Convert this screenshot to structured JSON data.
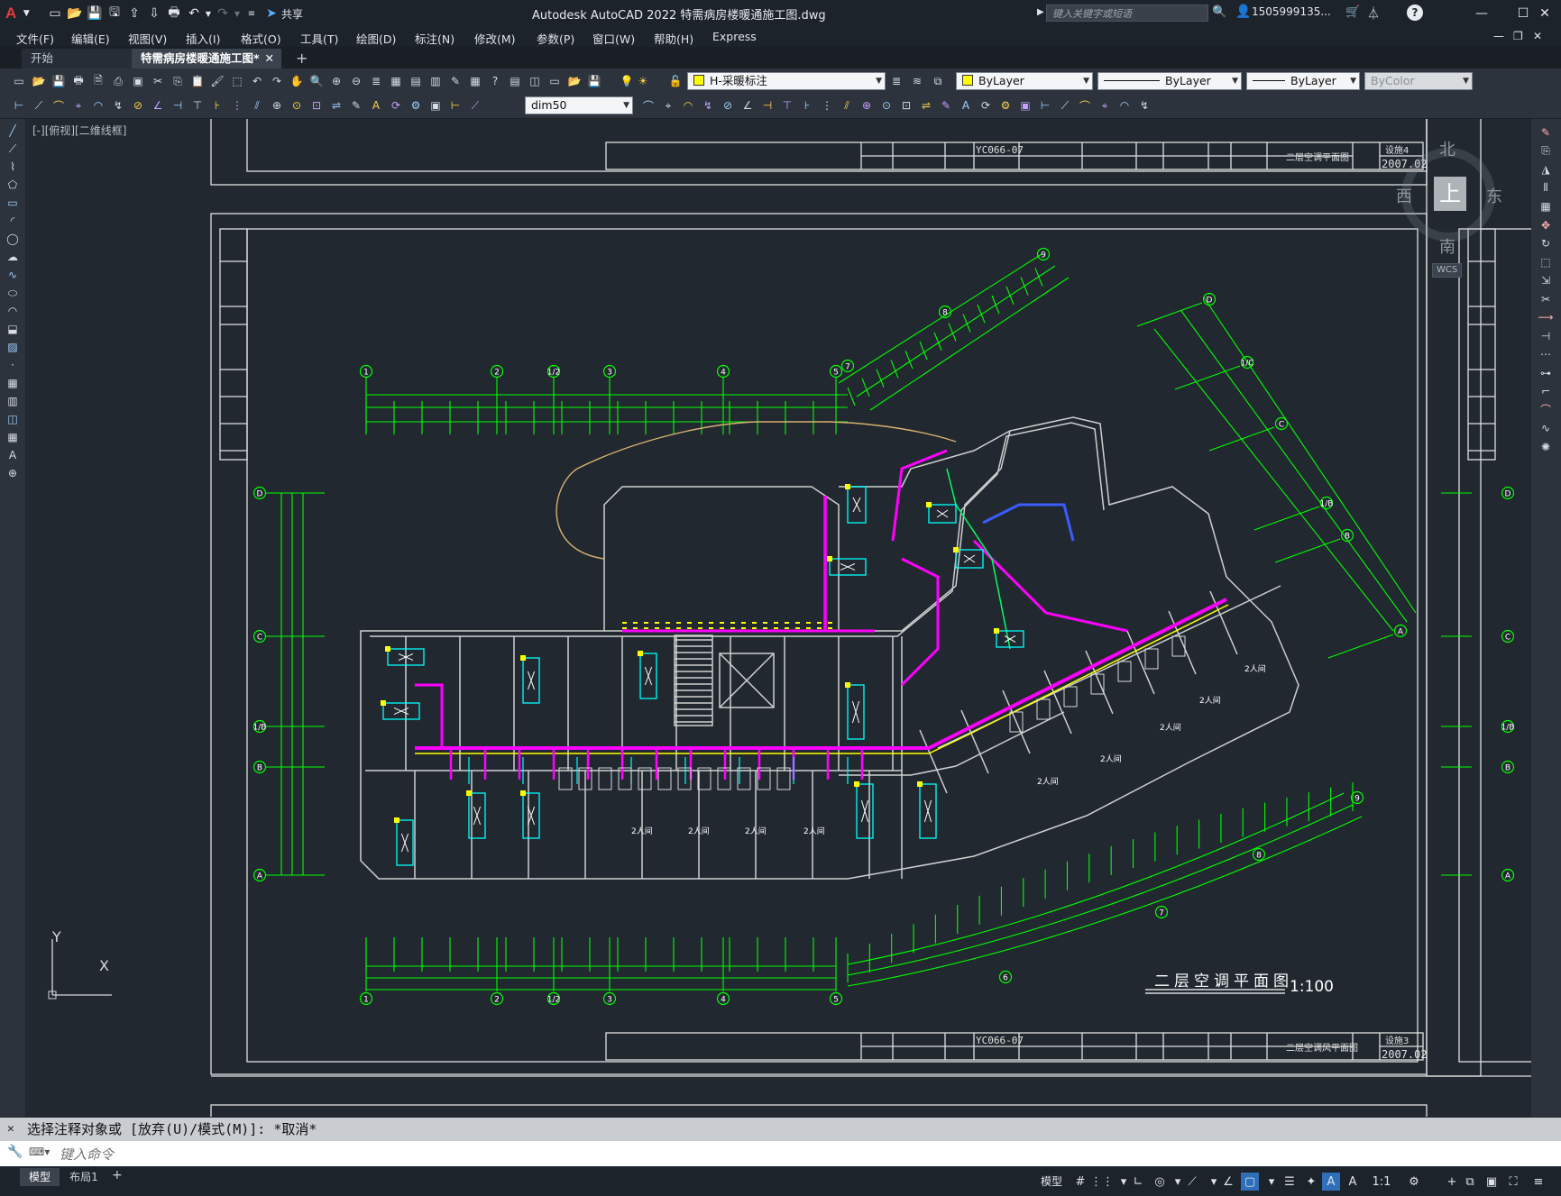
{
  "app": {
    "title": "Autodesk AutoCAD 2022    特需病房楼暖通施工图.dwg",
    "logo": "A",
    "share_label": "共享",
    "search_placeholder": "键入关键字或短语",
    "user": "1505999135..."
  },
  "menu": [
    "文件(F)",
    "编辑(E)",
    "视图(V)",
    "插入(I)",
    "格式(O)",
    "工具(T)",
    "绘图(D)",
    "标注(N)",
    "修改(M)",
    "参数(P)",
    "窗口(W)",
    "帮助(H)",
    "Express"
  ],
  "tabs": [
    {
      "label": "开始",
      "active": false
    },
    {
      "label": "特需病房楼暖通施工图*",
      "active": true
    }
  ],
  "toolbar": {
    "layer": "H-采暖标注",
    "color": "ByLayer",
    "linetype": "ByLayer",
    "lineweight": "ByLayer",
    "plotstyle": "ByColor",
    "dimstyle": "dim50"
  },
  "viewport": {
    "label": "[-][俯视][二维线框]",
    "viewcube": {
      "north": "北",
      "south": "南",
      "east": "东",
      "west": "西",
      "top": "上",
      "wcs": "WCS"
    }
  },
  "drawing": {
    "title": "二层空调平面图",
    "scale": "1:100",
    "title_block": {
      "project_no": "YC066-07",
      "drawing_no": "设施4",
      "date": "2007.02",
      "drawing_name": "二层空调平面图",
      "lower_drawing_name": "二层空调风平面图",
      "lower_drawing_no": "设施3",
      "lower_date": "2007.02"
    },
    "grid_top": [
      "1",
      "2",
      "1/2",
      "3",
      "4",
      "5",
      "7",
      "8",
      "9"
    ],
    "grid_left": [
      "D",
      "C",
      "1/B",
      "B",
      "A"
    ],
    "grid_right_slanted": [
      "D",
      "1/C",
      "C",
      "1/B",
      "B",
      "A"
    ],
    "room_double": "2人间",
    "axis_y": "Y",
    "axis_x": "X"
  },
  "command": {
    "history": "选择注释对象或 [放弃(U)/模式(M)]: *取消*",
    "placeholder": "键入命令"
  },
  "status": {
    "tabs": [
      "模型",
      "布局1"
    ],
    "model_label": "模型",
    "scale": "1:1"
  },
  "colors": {
    "grid": "#00ff00",
    "duct_magenta": "#ff00ff",
    "equip_yellow": "#ffff00",
    "cyan": "#00ffff",
    "walls": "#d8d8d8"
  }
}
